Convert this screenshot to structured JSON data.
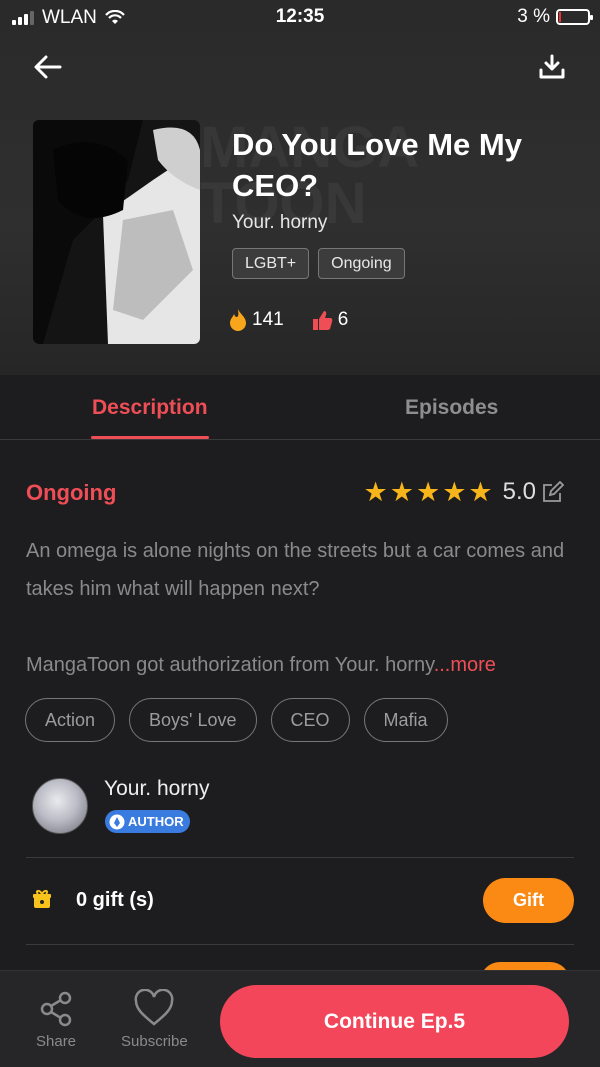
{
  "status_bar": {
    "carrier": "WLAN",
    "time": "12:35",
    "battery": "3 %"
  },
  "header": {
    "cover_watermark": "MANGA TOON",
    "title": "Do You Love Me My CEO?",
    "author": "Your. horny",
    "tags": [
      "LGBT+",
      "Ongoing"
    ],
    "likes": "141",
    "dislikes": "6"
  },
  "tabs": [
    {
      "label": "Description",
      "active": true
    },
    {
      "label": "Episodes",
      "active": false
    }
  ],
  "description": {
    "status": "Ongoing",
    "rating": "5.0",
    "stars": 5,
    "text": "An omega is alone nights on the streets but a car comes and takes him what will happen next?",
    "authorization": "MangaToon got authorization from Your. horny",
    "more_link": "...more",
    "genres": [
      "Action",
      "Boys' Love",
      "CEO",
      "Mafia"
    ]
  },
  "author": {
    "name": "Your. horny",
    "badge": "AUTHOR"
  },
  "gift": {
    "text": "0 gift (s)",
    "button": "Gift"
  },
  "bottom_bar": {
    "share": "Share",
    "subscribe": "Subscribe",
    "continue": "Continue Ep.5"
  },
  "colors": {
    "accent": "#f04e57",
    "gift_orange": "#fb8a14",
    "star": "#f8b51b",
    "badge_blue": "#3a7be0"
  }
}
